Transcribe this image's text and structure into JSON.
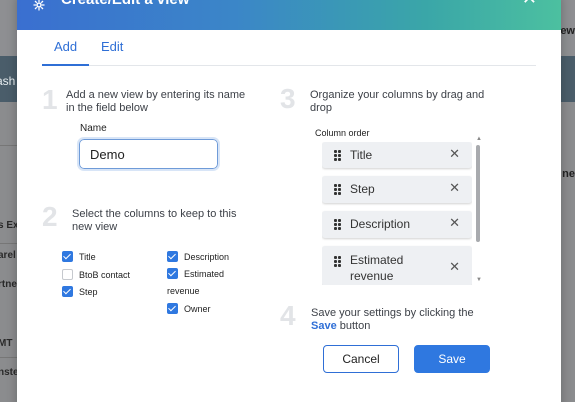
{
  "background": {
    "band_text": "ash",
    "left_texts": [
      "s Ex",
      "arel",
      "rtne",
      "MT",
      "nste"
    ],
    "right_texts": [
      "ew",
      "ne"
    ]
  },
  "modal": {
    "title": "Create/Edit a view",
    "tabs": [
      {
        "label": "Add",
        "active": true
      },
      {
        "label": "Edit",
        "active": false
      }
    ],
    "step1": {
      "number": "1",
      "text_line1": "Add a new view by entering its name",
      "text_line2": "in the field below",
      "name_label": "Name",
      "name_value": "Demo"
    },
    "step2": {
      "number": "2",
      "text_line1": "Select the columns to keep to this",
      "text_line2": "new view",
      "checkboxes": [
        {
          "label": "Title",
          "checked": true
        },
        {
          "label": "BtoB contact",
          "checked": false
        },
        {
          "label": "Step",
          "checked": true
        },
        {
          "label": "Description",
          "checked": true
        },
        {
          "label": "Estimated",
          "checked": true
        },
        {
          "label": "revenue",
          "checked": true
        },
        {
          "label": "Owner",
          "checked": true
        }
      ]
    },
    "step3": {
      "number": "3",
      "text_line1": "Organize your columns by drag and",
      "text_line2": "drop",
      "column_order_label": "Column order",
      "columns": [
        {
          "label": "Title"
        },
        {
          "label": "Step"
        },
        {
          "label": "Description"
        },
        {
          "label": "Estimated revenue"
        }
      ]
    },
    "step4": {
      "number": "4",
      "text_line1": "Save your settings by clicking the",
      "text_bold": "Save",
      "text_after": " button"
    },
    "buttons": {
      "cancel": "Cancel",
      "save": "Save"
    },
    "icons": {
      "header": "settings-icon",
      "close": "close-icon",
      "grip": "drag-handle-icon",
      "remove": "remove-icon"
    },
    "colors": {
      "accent": "#2f78e0",
      "header_start": "#3a6fd0",
      "header_end": "#4cc0a0"
    }
  }
}
